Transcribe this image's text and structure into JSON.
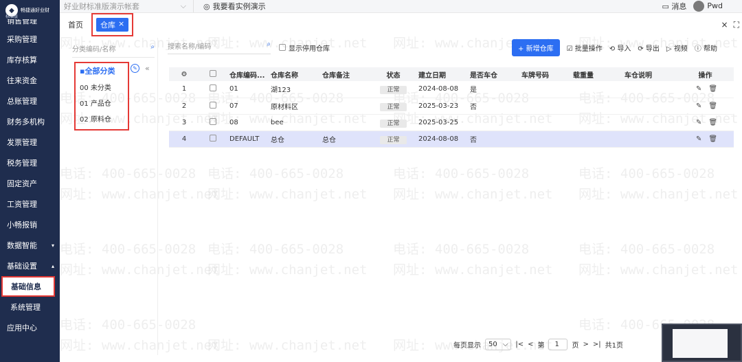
{
  "sidebar": {
    "logo_text": "畅捷通好业财",
    "edition": "标准版",
    "items": [
      {
        "label": "销售管理"
      },
      {
        "label": "采购管理"
      },
      {
        "label": "库存核算"
      },
      {
        "label": "往来资金"
      },
      {
        "label": "总账管理"
      },
      {
        "label": "财务多机构"
      },
      {
        "label": "发票管理"
      },
      {
        "label": "税务管理"
      },
      {
        "label": "固定资产"
      },
      {
        "label": "工资管理"
      },
      {
        "label": "小畅报销"
      },
      {
        "label": "数据智能",
        "arrow": "▾"
      },
      {
        "label": "基础设置",
        "arrow": "▴"
      },
      {
        "label": "基础信息"
      },
      {
        "label": "系统管理"
      },
      {
        "label": "应用中心"
      }
    ]
  },
  "topbar": {
    "account": "好业财标准版演示帐套",
    "demo_link": "我要看实例演示",
    "messages": "消息",
    "user": "Pwd"
  },
  "tabs": {
    "home": "首页",
    "active": "仓库",
    "close": "×",
    "win_close": "×",
    "win_expand": "⛶"
  },
  "category": {
    "search_placeholder": "分类编码/名称",
    "root": "全部分类",
    "items": [
      "00 未分类",
      "01 产品仓",
      "02 原料仓"
    ],
    "collapse": "«"
  },
  "toolbar": {
    "search_placeholder": "搜索名称/编码",
    "show_disabled": "显示停用仓库",
    "new_button": "+ 新增仓库",
    "batch": "批量操作",
    "import": "导入",
    "export": "导出",
    "video": "视频",
    "help": "帮助"
  },
  "table": {
    "headers": [
      "仓库编码...",
      "仓库名称",
      "仓库备注",
      "状态",
      "建立日期",
      "是否车仓",
      "车牌号码",
      "载重量",
      "车仓说明",
      "操作"
    ],
    "rows": [
      {
        "no": "1",
        "code": "01",
        "name": "湖123",
        "remark": "",
        "status": "正常",
        "date": "2024-08-08",
        "is_car": "是",
        "plate": "",
        "load": "",
        "desc": ""
      },
      {
        "no": "2",
        "code": "07",
        "name": "原材料区",
        "remark": "",
        "status": "正常",
        "date": "2025-03-23",
        "is_car": "否",
        "plate": "",
        "load": "",
        "desc": ""
      },
      {
        "no": "3",
        "code": "08",
        "name": "bee",
        "remark": "",
        "status": "正常",
        "date": "2025-03-25",
        "is_car": "",
        "plate": "",
        "load": "",
        "desc": ""
      },
      {
        "no": "4",
        "code": "DEFAULT",
        "name": "总仓",
        "remark": "总仓",
        "status": "正常",
        "date": "2024-08-08",
        "is_car": "否",
        "plate": "",
        "load": "",
        "desc": ""
      }
    ]
  },
  "pager": {
    "per_page_label": "每页显示",
    "per_page": "50",
    "page_prefix": "第",
    "page": "1",
    "page_suffix": "页",
    "total": "共1页"
  },
  "watermark": {
    "phone": "电话: 400-665-0028",
    "site": "网址: www.chanjet.net"
  }
}
